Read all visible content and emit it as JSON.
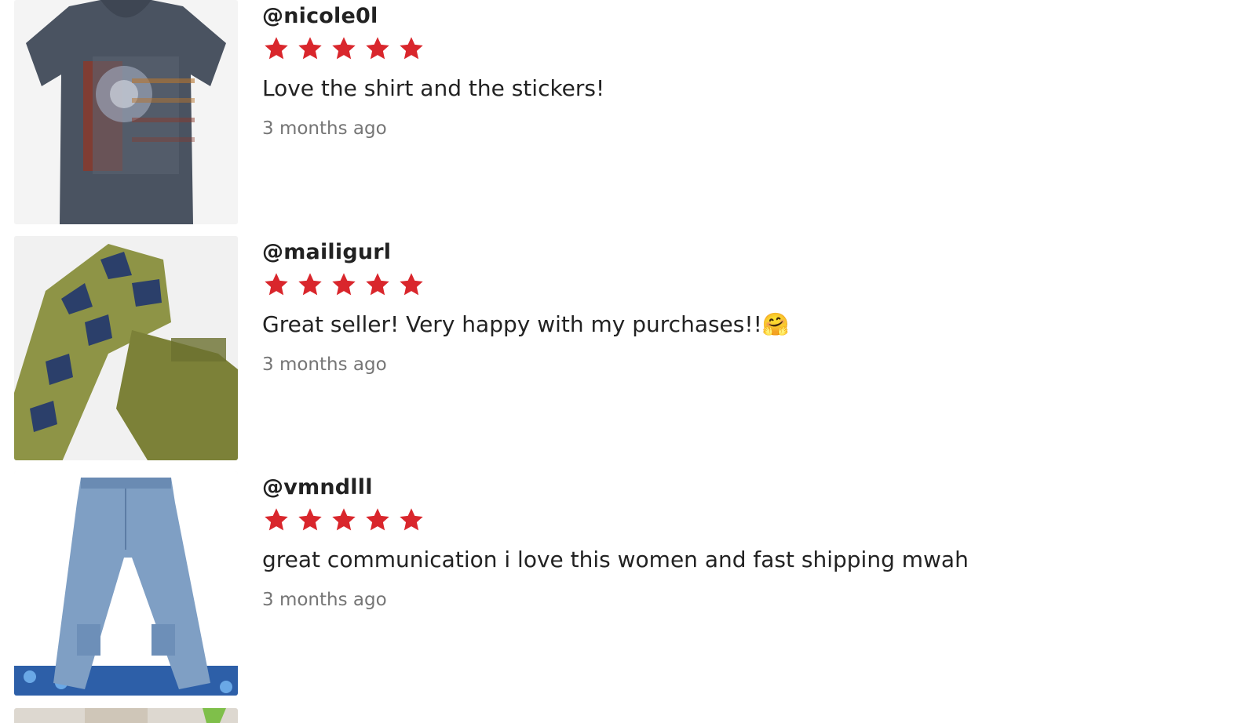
{
  "reviews": [
    {
      "username": "@nicole0l",
      "rating": 5,
      "comment": "Love the shirt and the stickers!",
      "time": "3 months ago",
      "image": "gray-tshirt-with-sun-print"
    },
    {
      "username": "@mailigurl",
      "rating": 5,
      "comment": "Great seller! Very happy with my purchases!!🤗",
      "time": "3 months ago",
      "image": "olive-tie-dye-set"
    },
    {
      "username": "@vmndlll",
      "rating": 5,
      "comment": "great communication i love this women and fast shipping mwah",
      "time": "3 months ago",
      "image": "flared-cargo-jeans"
    }
  ],
  "colors": {
    "star": "#d9262c",
    "username": "#222222",
    "comment": "#222222",
    "timestamp": "#757575"
  }
}
